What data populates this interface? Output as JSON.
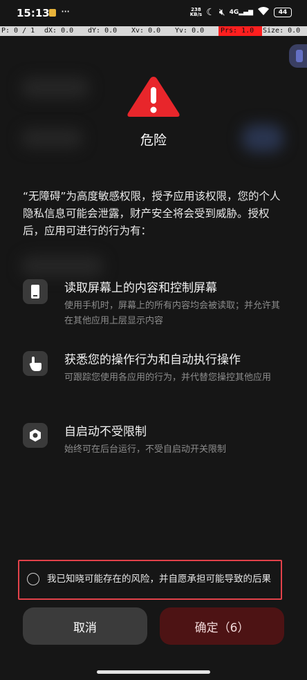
{
  "status_bar": {
    "time": "15:13",
    "dots": "···",
    "net_speed_value": "238",
    "net_speed_unit": "KB/s",
    "signal_label": "4G",
    "battery": "44"
  },
  "pointer_bar": {
    "p": "P: 0 / 1",
    "dx": "dX: 0.0",
    "dy": "dY: 0.0",
    "xv": "Xv: 0.0",
    "yv": "Yv: 0.0",
    "prs": "Prs: 1.0",
    "size": "Size: 0.0"
  },
  "dialog": {
    "title": "危险",
    "description": "“无障碍”为高度敏感权限，授予应用该权限，您的个人隐私信息可能会泄露，财产安全将会受到威胁。授权后，应用可进行的行为有：",
    "permissions": [
      {
        "icon": "phone-screen-icon",
        "title": "读取屏幕上的内容和控制屏幕",
        "desc": "使用手机时，屏幕上的所有内容均会被读取；并允许其在其他应用上层显示内容"
      },
      {
        "icon": "hand-touch-icon",
        "title": "获悉您的操作行为和自动执行操作",
        "desc": "可跟踪您使用各应用的行为，并代替您操控其他应用"
      },
      {
        "icon": "hexagon-icon",
        "title": "自启动不受限制",
        "desc": "始终可在后台运行，不受自启动开关限制"
      }
    ],
    "consent": "我已知晓可能存在的风险，并自愿承担可能导致的后果",
    "cancel_label": "取消",
    "confirm_label": "确定（6）"
  },
  "colors": {
    "background": "#161616",
    "warning_red": "#e8262b",
    "highlight_border": "#e3424a",
    "confirm_button": "#4d1314"
  }
}
